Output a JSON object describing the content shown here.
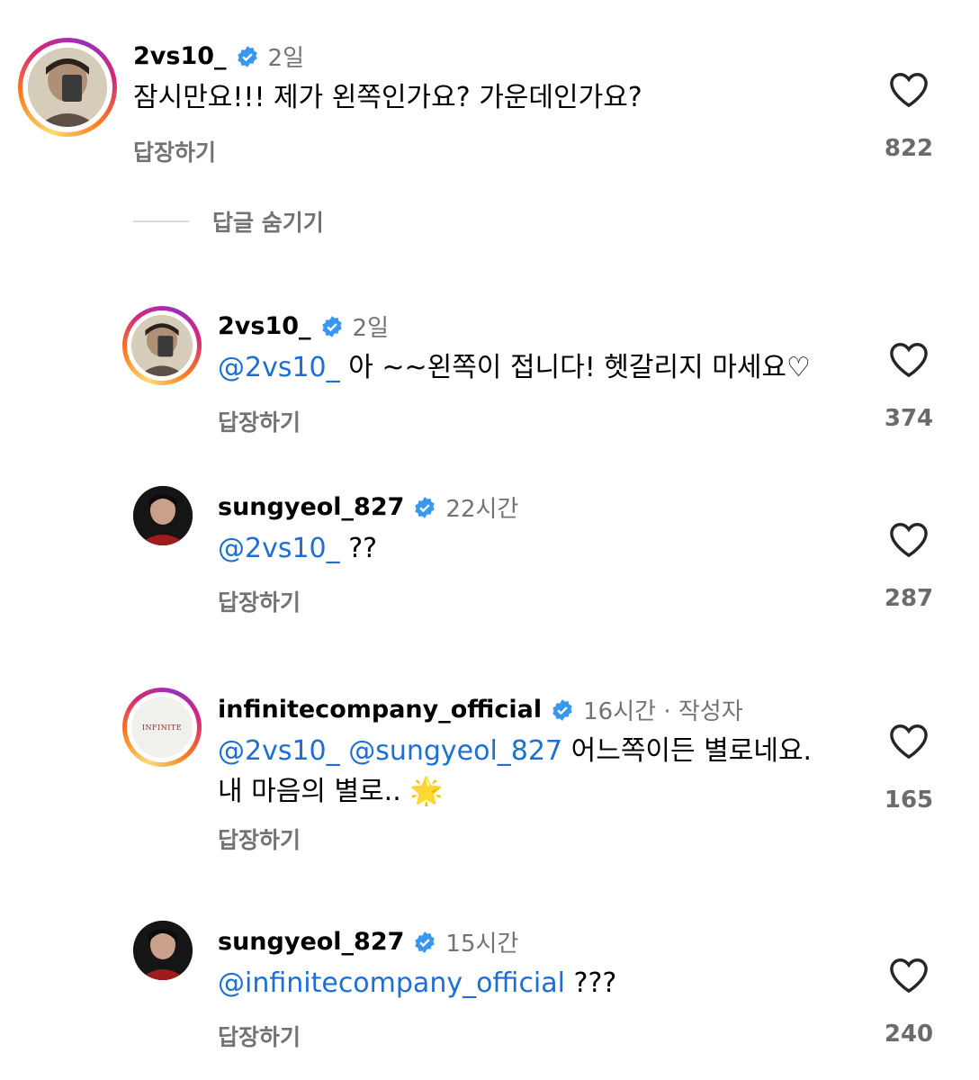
{
  "comments": [
    {
      "username": "2vs10_",
      "time": "2일",
      "mentions": [],
      "text_line1": "잠시만요!!! 제가 왼쪽인가요? 가운데인가요?",
      "text_line2": "",
      "reply_label": "답장하기",
      "likes": "822"
    },
    {
      "username": "2vs10_",
      "time": "2일",
      "mentions": [
        "@2vs10_"
      ],
      "text_line1": " 아 ~~왼쪽이 접니다! 헷갈리지 마세요♡",
      "text_line2": "",
      "reply_label": "답장하기",
      "likes": "374"
    },
    {
      "username": "sungyeol_827",
      "time": "22시간",
      "mentions": [
        "@2vs10_"
      ],
      "text_line1": " ??",
      "text_line2": "",
      "reply_label": "답장하기",
      "likes": "287"
    },
    {
      "username": "infinitecompany_official",
      "time": "16시간 · 작성자",
      "mentions": [
        "@2vs10_",
        "@sungyeol_827"
      ],
      "text_line1": " 어느쪽이든 별로네요.",
      "text_line2": "내 마음의 별로.. 🌟",
      "reply_label": "답장하기",
      "likes": "165",
      "avatar_text": "INFINITE"
    },
    {
      "username": "sungyeol_827",
      "time": "15시간",
      "mentions": [
        "@infinitecompany_official"
      ],
      "text_line1": " ???",
      "text_line2": "",
      "reply_label": "답장하기",
      "likes": "240"
    }
  ],
  "hide_replies_label": "답글 숨기기",
  "colors": {
    "mention": "#1d6fd6",
    "verified": "#3897f0",
    "muted": "#737373"
  }
}
